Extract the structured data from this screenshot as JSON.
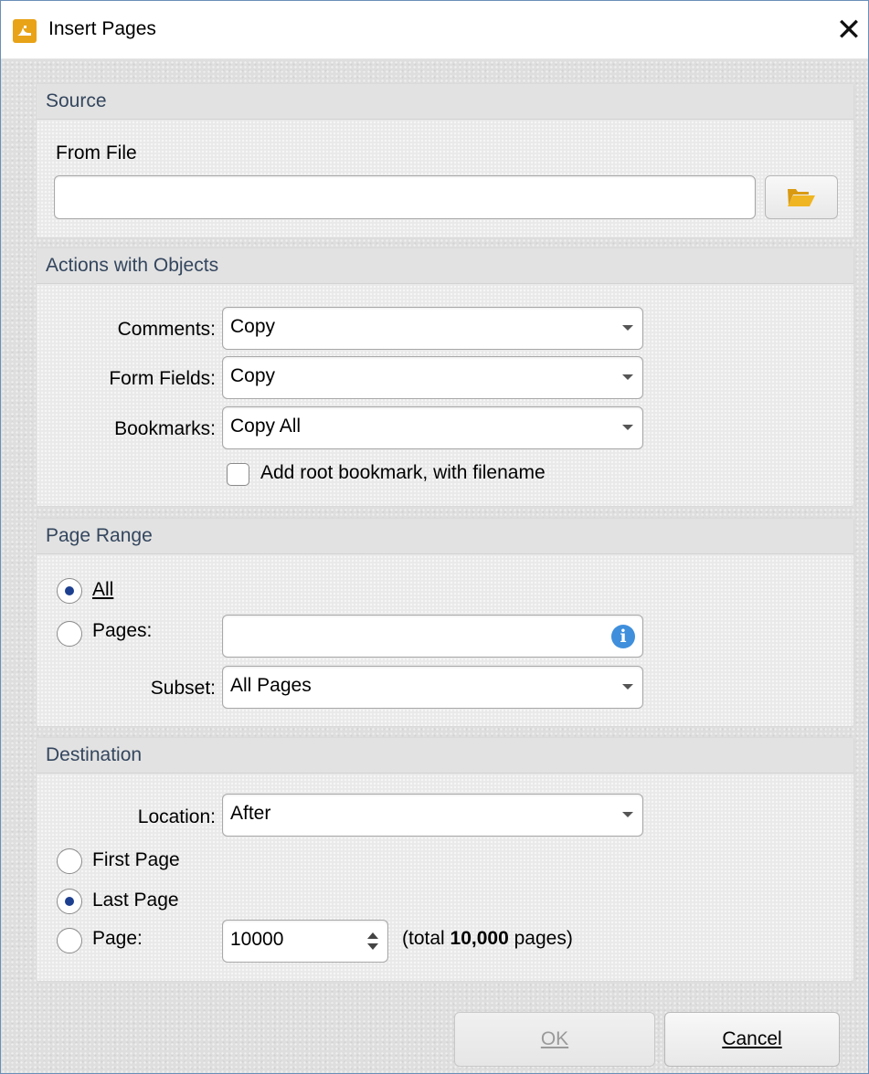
{
  "dialog": {
    "title": "Insert Pages",
    "close_symbol": "✕"
  },
  "source": {
    "header": "Source",
    "from_file_label": "From File",
    "file_path_value": "",
    "browse_icon": "folder-open-icon"
  },
  "actions": {
    "header": "Actions with Objects",
    "comments_label": "Comments:",
    "comments_value": "Copy",
    "form_fields_label": "Form Fields:",
    "form_fields_value": "Copy",
    "bookmarks_label": "Bookmarks:",
    "bookmarks_value": "Copy All",
    "root_bookmark_label": "Add root bookmark, with filename",
    "root_bookmark_checked": false
  },
  "page_range": {
    "header": "Page Range",
    "all_label": "All",
    "all_checked": true,
    "pages_label": "Pages:",
    "pages_checked": false,
    "pages_value": "",
    "info_icon": "info-icon",
    "subset_label": "Subset:",
    "subset_value": "All Pages"
  },
  "destination": {
    "header": "Destination",
    "location_label": "Location:",
    "location_value": "After",
    "first_page_label": "First Page",
    "first_page_checked": false,
    "last_page_label": "Last Page",
    "last_page_checked": true,
    "page_label": "Page:",
    "page_checked": false,
    "page_value": "10000",
    "total_prefix": "(total ",
    "total_count": "10,000",
    "total_suffix": " pages)"
  },
  "buttons": {
    "ok_label": "OK",
    "cancel_label": "Cancel"
  },
  "colors": {
    "accent": "#1d3f8f",
    "folder": "#f0b522",
    "group_title": "#34465e"
  }
}
